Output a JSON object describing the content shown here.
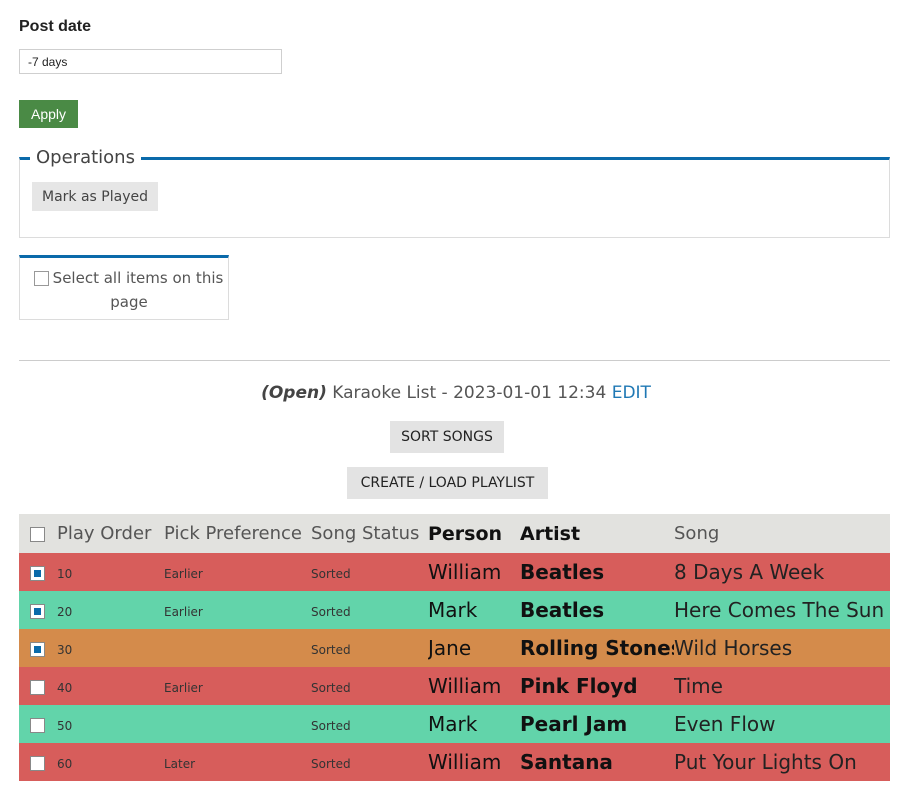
{
  "filter": {
    "post_date_label": "Post date",
    "post_date_value": "-7 days",
    "apply_label": "Apply"
  },
  "operations": {
    "legend": "Operations",
    "mark_played_label": "Mark as Played"
  },
  "select_all": {
    "label": "Select all items on this page",
    "checked": false
  },
  "list": {
    "status": "(Open)",
    "title": " Karaoke List - 2023-01-01 12:34 ",
    "edit_label": "EDIT",
    "sort_label": "SORT SONGS",
    "playlist_label": "CREATE / LOAD PLAYLIST"
  },
  "table": {
    "headers": {
      "play_order": "Play Order",
      "pick_preference": "Pick Preference",
      "song_status": "Song Status",
      "person": "Person",
      "artist": "Artist",
      "song": "Song"
    },
    "rows": [
      {
        "checked": true,
        "color": "#d75d5b",
        "play_order": "10",
        "pick_preference": "Earlier",
        "song_status": "Sorted",
        "person": "William",
        "artist": "Beatles",
        "song": "8 Days A Week"
      },
      {
        "checked": true,
        "color": "#62d4aa",
        "play_order": "20",
        "pick_preference": "Earlier",
        "song_status": "Sorted",
        "person": "Mark",
        "artist": "Beatles",
        "song": "Here Comes The Sun"
      },
      {
        "checked": true,
        "color": "#d48b4b",
        "play_order": "30",
        "pick_preference": "",
        "song_status": "Sorted",
        "person": "Jane",
        "artist": "Rolling Stones",
        "song": "Wild Horses"
      },
      {
        "checked": false,
        "color": "#d75d5b",
        "play_order": "40",
        "pick_preference": "Earlier",
        "song_status": "Sorted",
        "person": "William",
        "artist": "Pink Floyd",
        "song": "Time"
      },
      {
        "checked": false,
        "color": "#62d4aa",
        "play_order": "50",
        "pick_preference": "",
        "song_status": "Sorted",
        "person": "Mark",
        "artist": "Pearl Jam",
        "song": "Even Flow"
      },
      {
        "checked": false,
        "color": "#d75d5b",
        "play_order": "60",
        "pick_preference": "Later",
        "song_status": "Sorted",
        "person": "William",
        "artist": "Santana",
        "song": "Put Your Lights On"
      }
    ]
  },
  "colors": {
    "accent": "#0a6aaa",
    "apply_button": "#4a8a45",
    "edit_link": "#1f78b4"
  }
}
